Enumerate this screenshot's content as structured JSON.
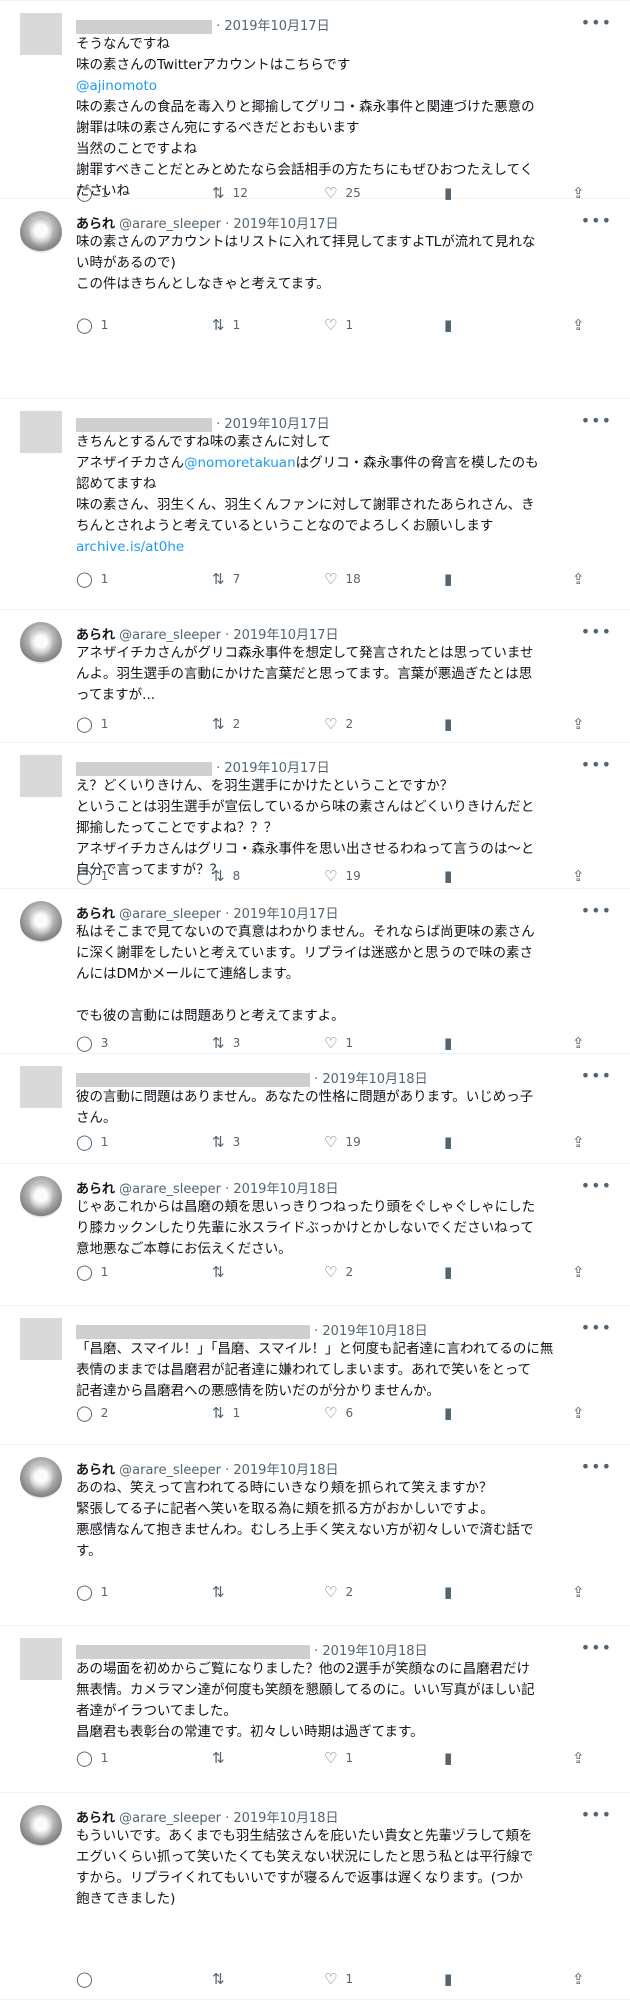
{
  "icons": {
    "reply": "reply-icon",
    "retweet": "retweet-icon",
    "like": "heart-icon",
    "views": "views-icon",
    "share": "share-icon",
    "more": "more-icon"
  },
  "tweets": [
    {
      "author": "",
      "handle": "",
      "date": "· 2019年10月17日",
      "redacted": true,
      "lines": [
        "そうなんですね",
        "味の素さんのTwitterアカウントはこちらです",
        "@ajinomoto",
        "味の素さんの食品を毒入りと揶揄してグリコ・森永事件と関連づけた悪意の",
        "謝罪は味の素さん宛にするべきだとおもいます",
        "当然のことですよね",
        "謝罪すべきことだとみとめたなら会話相手の方たちにもぜひおつたえしてく",
        "ださいね"
      ],
      "replies": "1",
      "retweets": "12",
      "likes": "25"
    },
    {
      "author": "あられ",
      "handle": "@arare_sleeper",
      "date": "· 2019年10月17日",
      "redacted": false,
      "lines": [
        "味の素さんのアカウントはリストに入れて拝見してますよTLが流れて見れな",
        "い時があるので)",
        "この件はきちんとしなきゃと考えてます。"
      ],
      "replies": "1",
      "retweets": "1",
      "likes": "1"
    },
    {
      "author": "",
      "handle": "",
      "date": "· 2019年10月17日",
      "redacted": true,
      "lines": [
        "きちんとするんですね味の素さんに対して",
        "アネザイチカさん@nomoretakuanはグリコ・森永事件の脅言を模したのも",
        "認めてますね",
        "味の素さん、羽生くん、羽生くんファンに対して謝罪されたあられさん、き",
        "ちんとされようと考えているということなのでよろしくお願いします",
        "archive.is/at0he"
      ],
      "replies": "1",
      "retweets": "7",
      "likes": "18"
    },
    {
      "author": "あられ",
      "handle": "@arare_sleeper",
      "date": "· 2019年10月17日",
      "redacted": false,
      "lines": [
        "アネザイチカさんがグリコ森永事件を想定して発言されたとは思っていませ",
        "んよ。羽生選手の言動にかけた言葉だと思ってます。言葉が悪過ぎたとは思",
        "ってますが..."
      ],
      "replies": "1",
      "retweets": "2",
      "likes": "2"
    },
    {
      "author": "",
      "handle": "",
      "date": "· 2019年10月17日",
      "redacted": true,
      "lines": [
        "え？どくいりきけん、を羽生選手にかけたということですか？",
        "ということは羽生選手が宣伝しているから味の素さんはどくいりきけんだと",
        "揶揄したってことですよね？？？",
        "アネザイチカさんはグリコ・森永事件を思い出させるわねって言うのは〜と",
        "自分で言ってますが？？"
      ],
      "replies": "1",
      "retweets": "8",
      "likes": "19"
    },
    {
      "author": "あられ",
      "handle": "@arare_sleeper",
      "date": "· 2019年10月17日",
      "redacted": false,
      "lines": [
        "私はそこまで見てないので真意はわかりません。それならば尚更味の素さん",
        "に深く謝罪をしたいと考えています。リプライは迷惑かと思うので味の素さ",
        "んにはDMかメールにて連絡します。",
        "",
        "でも彼の言動には問題ありと考えてますよ。"
      ],
      "replies": "3",
      "retweets": "3",
      "likes": "1"
    },
    {
      "author": "",
      "handle": "",
      "date": "· 2019年10月18日",
      "redacted": true,
      "lines": [
        "彼の言動に問題はありません。あなたの性格に問題があります。いじめっ子",
        "さん。"
      ],
      "replies": "1",
      "retweets": "3",
      "likes": "19"
    },
    {
      "author": "あられ",
      "handle": "@arare_sleeper",
      "date": "· 2019年10月18日",
      "redacted": false,
      "lines": [
        "じゃあこれからは昌磨の頬を思いっきりつねったり頭をぐしゃぐしゃにした",
        "り膝カックンしたり先輩に氷スライドぶっかけとかしないでくださいねって",
        "意地悪なご本尊にお伝えください。"
      ],
      "replies": "1",
      "retweets": "",
      "likes": "2"
    },
    {
      "author": "",
      "handle": "",
      "date": "· 2019年10月18日",
      "redacted": true,
      "lines": [
        "「昌磨、スマイル！」「昌磨、スマイル！」と何度も記者達に言われてるのに無",
        "表情のままでは昌磨君が記者達に嫌われてしまいます。あれで笑いをとって",
        "記者達から昌磨君への悪感情を防いだのが分かりませんか。"
      ],
      "replies": "2",
      "retweets": "1",
      "likes": "6"
    },
    {
      "author": "あられ",
      "handle": "@arare_sleeper",
      "date": "· 2019年10月18日",
      "redacted": false,
      "lines": [
        "あのね、笑えって言われてる時にいきなり頬を抓られて笑えますか？",
        "緊張してる子に記者へ笑いを取る為に頬を抓る方がおかしいですよ。",
        "悪感情なんて抱きませんわ。むしろ上手く笑えない方が初々しいで済む話で",
        "す。"
      ],
      "replies": "1",
      "retweets": "",
      "likes": "2"
    },
    {
      "author": "",
      "handle": "",
      "date": "· 2019年10月18日",
      "redacted": true,
      "lines": [
        "あの場面を初めからご覧になりました？他の2選手が笑顔なのに昌磨君だけ",
        "無表情。カメラマン達が何度も笑顔を懇願してるのに。いい写真がほしい記",
        "者達がイラついてました。",
        "昌磨君も表彰台の常連です。初々しい時期は過ぎてます。"
      ],
      "replies": "1",
      "retweets": "",
      "likes": "1"
    },
    {
      "author": "あられ",
      "handle": "@arare_sleeper",
      "date": "· 2019年10月18日",
      "redacted": false,
      "lines": [
        "もういいです。あくまでも羽生結弦さんを庇いたい貴女と先輩ヅラして頬を",
        "エグいくらい抓って笑いたくても笑えない状況にしたと思う私とは平行線で",
        "すから。リプライくれてもいいですが寝るんで返事は遅くなります。(つか",
        "飽きてきました)"
      ],
      "replies": "",
      "retweets": "",
      "likes": "1"
    }
  ]
}
